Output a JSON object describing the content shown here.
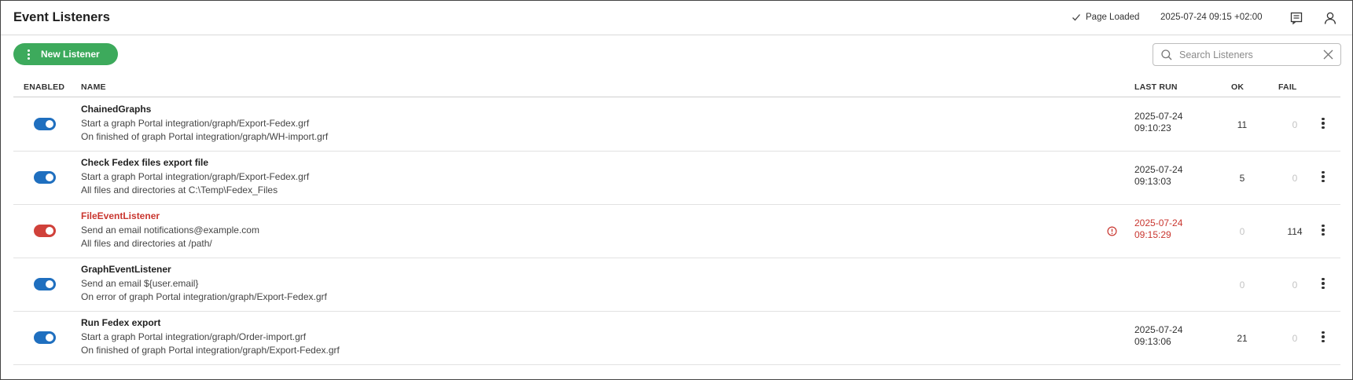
{
  "header": {
    "title": "Event Listeners",
    "status": "Page Loaded",
    "timestamp": "2025-07-24 09:15 +02:00",
    "icons": [
      "notes-icon",
      "user-icon"
    ]
  },
  "toolbar": {
    "new_label": "New Listener",
    "search_placeholder": "Search Listeners",
    "search_value": ""
  },
  "columns": {
    "enabled": "ENABLED",
    "name": "NAME",
    "last_run": "LAST RUN",
    "ok": "OK",
    "fail": "FAIL"
  },
  "colors": {
    "accent_green": "#3daa5c",
    "toggle_blue": "#1f6fbf",
    "error_red": "#c9362f"
  },
  "rows": [
    {
      "name": "ChainedGraphs",
      "enabled": true,
      "error": false,
      "line1": "Start a graph Portal integration/graph/Export-Fedex.grf",
      "line2": "On finished of graph Portal integration/graph/WH-import.grf",
      "last_run_date": "2025-07-24",
      "last_run_time": "09:10:23",
      "ok": "11",
      "fail": "0"
    },
    {
      "name": "Check Fedex files export file",
      "enabled": true,
      "error": false,
      "line1": "Start a graph Portal integration/graph/Export-Fedex.grf",
      "line2": "All files and directories at C:\\Temp\\Fedex_Files",
      "last_run_date": "2025-07-24",
      "last_run_time": "09:13:03",
      "ok": "5",
      "fail": "0"
    },
    {
      "name": "FileEventListener",
      "enabled": true,
      "error": true,
      "line1": "Send an email notifications@example.com",
      "line2": "All files and directories at /path/",
      "last_run_date": "2025-07-24",
      "last_run_time": "09:15:29",
      "ok": "0",
      "fail": "114"
    },
    {
      "name": "GraphEventListener",
      "enabled": true,
      "error": false,
      "line1": "Send an email ${user.email}",
      "line2": "On error of graph Portal integration/graph/Export-Fedex.grf",
      "last_run_date": "",
      "last_run_time": "",
      "ok": "0",
      "fail": "0"
    },
    {
      "name": "Run Fedex export",
      "enabled": true,
      "error": false,
      "line1": "Start a graph Portal integration/graph/Order-import.grf",
      "line2": "On finished of graph Portal integration/graph/Export-Fedex.grf",
      "last_run_date": "2025-07-24",
      "last_run_time": "09:13:06",
      "ok": "21",
      "fail": "0"
    }
  ]
}
